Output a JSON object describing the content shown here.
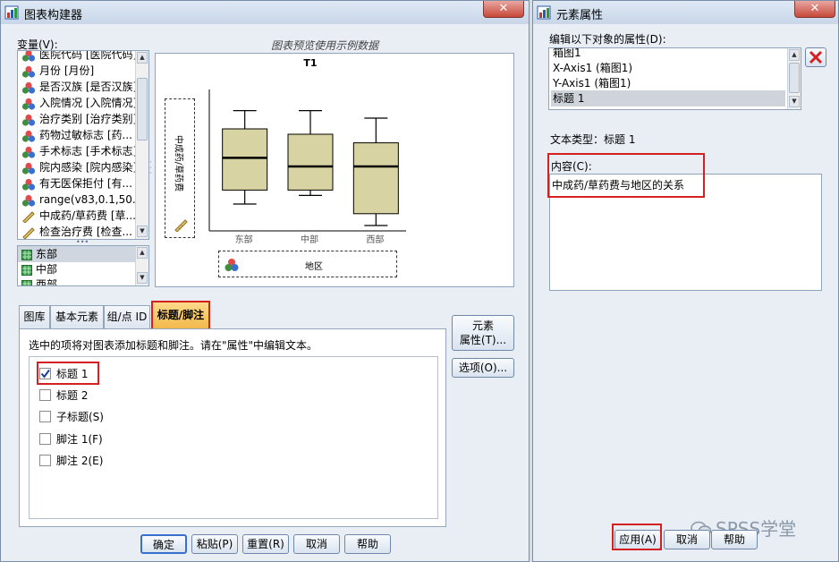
{
  "left_window": {
    "title": "图表构建器",
    "variables_label": "变量(V):",
    "preview_note": "图表预览使用示例数据",
    "variables": [
      "医院代码 [医院代码]",
      "月份 [月份]",
      "是否汉族 [是否汉族]",
      "入院情况 [入院情况]",
      "治疗类别 [治疗类别]",
      "药物过敏标志 [药...",
      "手术标志 [手术标志]",
      "院内感染 [院内感染]",
      "有无医保拒付 [有...",
      "range(v83,0.1,50...",
      "中成药/草药费 [草...",
      "检查治疗费 [检查..."
    ],
    "categories": [
      "东部",
      "中部",
      "西部"
    ],
    "tabs": [
      "图库",
      "基本元素",
      "组/点 ID",
      "标题/脚注"
    ],
    "tab_desc": "选中的项将对图表添加标题和脚注。请在\"属性\"中编辑文本。",
    "checks": [
      {
        "label": "标题 1",
        "checked": true
      },
      {
        "label": "标题 2",
        "checked": false
      },
      {
        "label": "子标题(S)",
        "checked": false
      },
      {
        "label": "脚注 1(F)",
        "checked": false
      },
      {
        "label": "脚注 2(E)",
        "checked": false
      }
    ],
    "side_buttons": {
      "element_props_l1": "元素",
      "element_props_l2": "属性(T)...",
      "options": "选项(O)..."
    },
    "bottom_buttons": [
      "确定",
      "粘贴(P)",
      "重置(R)",
      "取消",
      "帮助"
    ]
  },
  "chart_data": {
    "type": "box",
    "title": "T1",
    "categories": [
      "东部",
      "中部",
      "西部"
    ],
    "xlabel": "地区",
    "ylabel": "中成药/草药费",
    "series": [
      {
        "name": "东部",
        "whisker_low": 2.5,
        "q1": 3.8,
        "median": 6.8,
        "q3": 9.5,
        "whisker_high": 11.2
      },
      {
        "name": "中部",
        "whisker_low": 3.3,
        "q1": 3.8,
        "median": 6.0,
        "q3": 9.0,
        "whisker_high": 11.2
      },
      {
        "name": "西部",
        "whisker_low": 0.5,
        "q1": 1.6,
        "median": 6.0,
        "q3": 8.2,
        "whisker_high": 10.5
      }
    ],
    "ylim": [
      0,
      13
    ],
    "grid": false,
    "legend": "none"
  },
  "right_window": {
    "title": "元素属性",
    "edit_label": "编辑以下对象的属性(D):",
    "props": [
      "箱图1",
      "X-Axis1 (箱图1)",
      "Y-Axis1 (箱图1)",
      "标题 1"
    ],
    "text_type_label": "文本类型：",
    "text_type_value": "标题 1",
    "content_label": "内容(C):",
    "content_value": "中成药/草药费与地区的关系",
    "buttons": [
      "应用(A)",
      "取消",
      "帮助"
    ]
  },
  "watermark": "SPSS学堂"
}
